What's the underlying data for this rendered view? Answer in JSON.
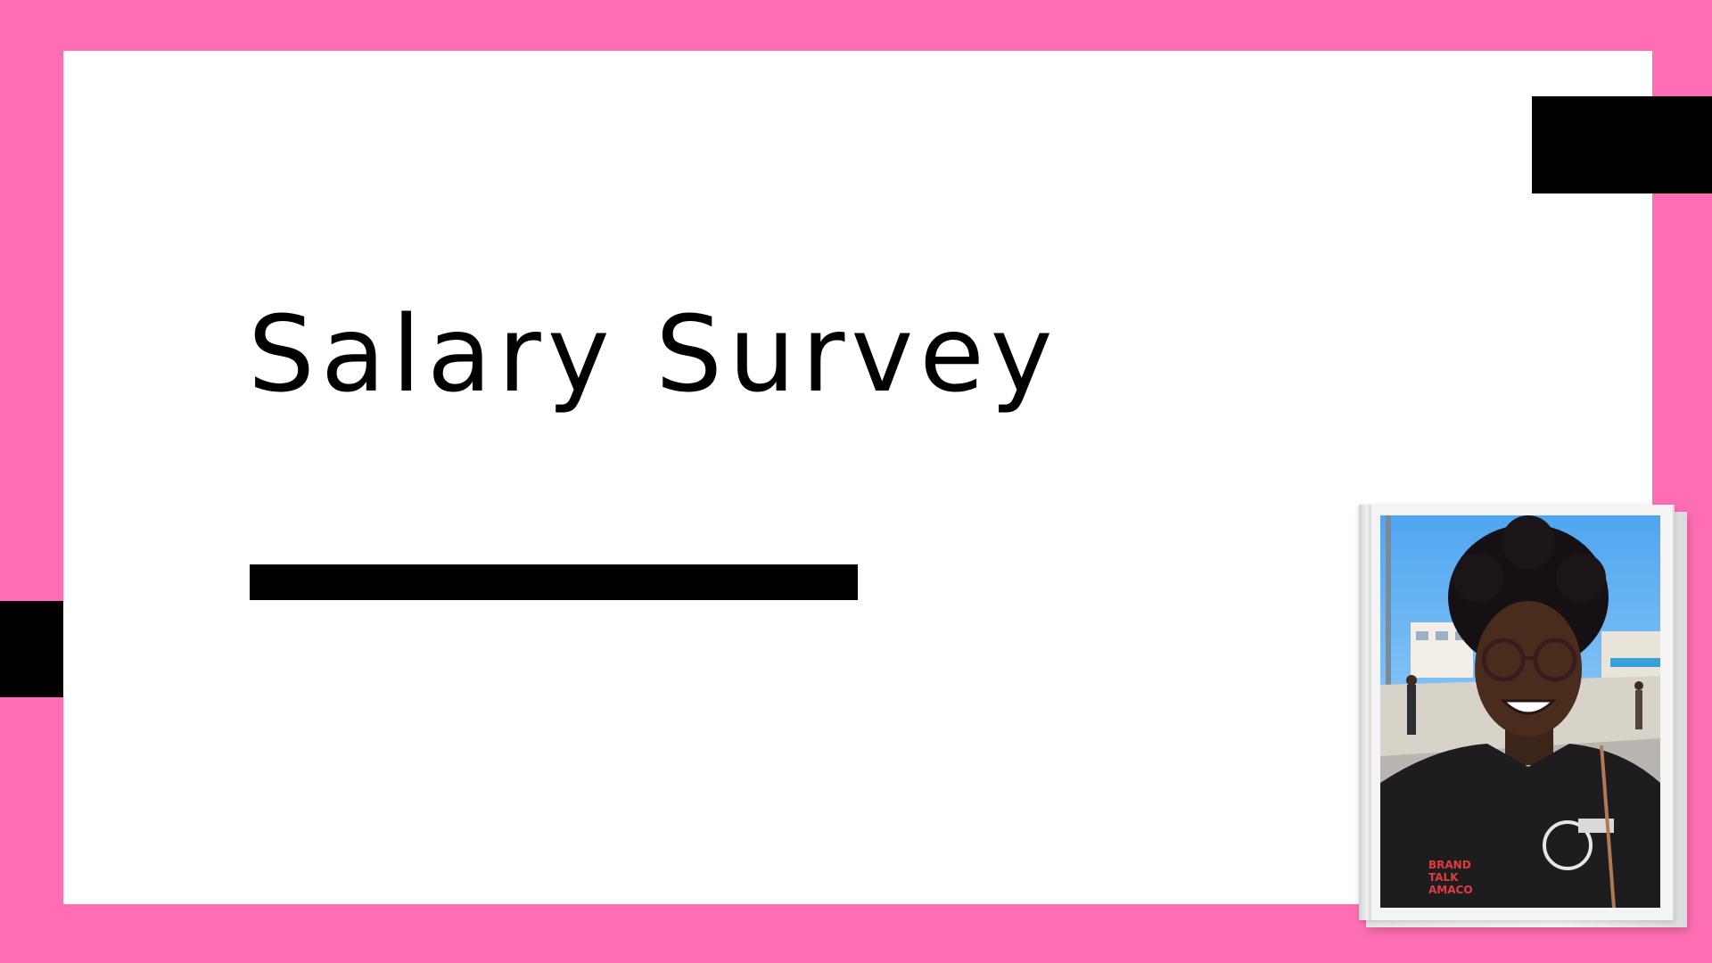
{
  "slide": {
    "title": "Salary Survey"
  },
  "colors": {
    "frame": "#ff6eb4",
    "panel": "#ffffff",
    "accent": "#000000",
    "text": "#000000"
  },
  "photo": {
    "subject": "portrait-photo",
    "shirt_text": [
      "BRAND",
      "TALK",
      "AMACO"
    ]
  }
}
